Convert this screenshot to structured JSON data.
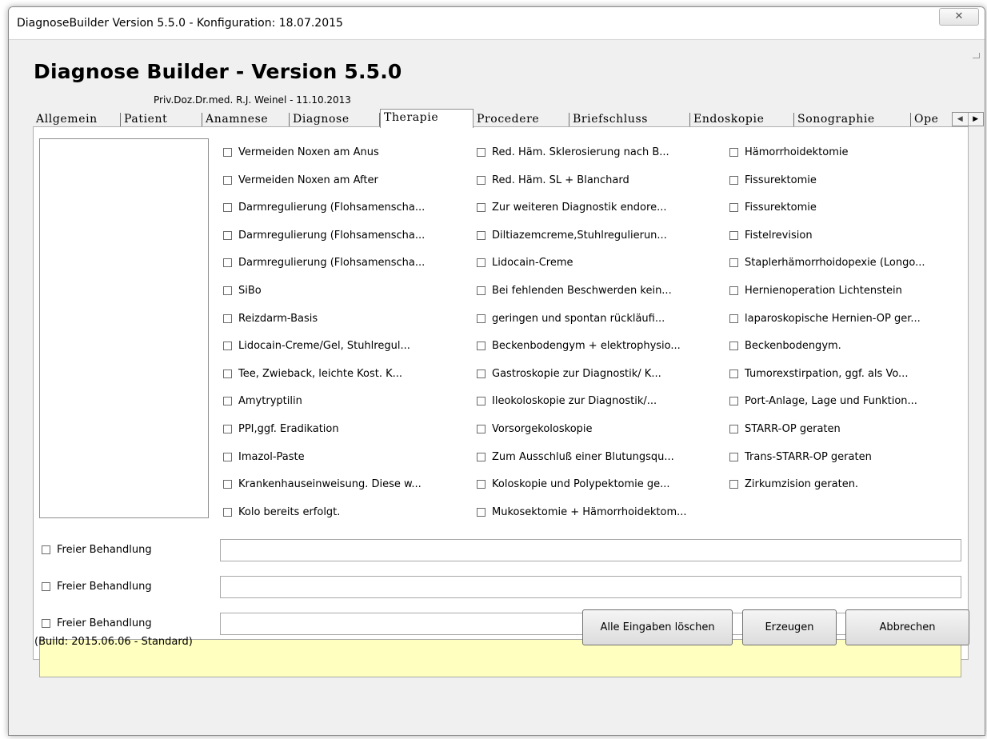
{
  "window": {
    "title": "DiagnoseBuilder Version 5.5.0 - Konfiguration: 18.07.2015",
    "close_glyph": "✕"
  },
  "header": {
    "app_title": "Diagnose Builder - Version 5.5.0",
    "author": "Priv.Doz.Dr.med. R.J. Weinel - 11.10.2013"
  },
  "tabs": [
    {
      "label": "Allgemein"
    },
    {
      "label": "Patient"
    },
    {
      "label": "Anamnese"
    },
    {
      "label": "Diagnose"
    },
    {
      "label": "Therapie",
      "active": true
    },
    {
      "label": "Procedere"
    },
    {
      "label": "Briefschluss"
    },
    {
      "label": "Endoskopie"
    },
    {
      "label": "Sonographie"
    },
    {
      "label": "Ope"
    }
  ],
  "tab_scroll": {
    "left": "◀",
    "right": "▶"
  },
  "checkbox_columns": [
    [
      "Vermeiden Noxen am Anus",
      "Vermeiden Noxen am After",
      "Darmregulierung (Flohsamenscha...",
      "Darmregulierung (Flohsamenscha...",
      "Darmregulierung (Flohsamenscha...",
      "SiBo",
      "Reizdarm-Basis",
      "Lidocain-Creme/Gel, Stuhlregul...",
      "Tee, Zwieback, leichte Kost. K...",
      "Amytryptilin",
      "PPI,ggf. Eradikation",
      "Imazol-Paste",
      "Krankenhauseinweisung. Diese w...",
      "Kolo bereits erfolgt."
    ],
    [
      "Red. Häm. Sklerosierung nach B...",
      "Red. Häm. SL + Blanchard",
      "Zur weiteren Diagnostik endore...",
      "Diltiazemcreme,Stuhlregulierun...",
      "Lidocain-Creme",
      "Bei fehlenden Beschwerden kein...",
      "geringen und spontan rückläufi...",
      "Beckenbodengym + elektrophysio...",
      "Gastroskopie zur Diagnostik/ K...",
      "Ileokoloskopie zur Diagnostik/...",
      "Vorsorgekoloskopie",
      "Zum Ausschluß einer Blutungsqu...",
      "Koloskopie und Polypektomie ge...",
      "Mukosektomie + Hämorrhoidektom..."
    ],
    [
      "Hämorrhoidektomie",
      "Fissurektomie",
      "Fissurektomie",
      "Fistelrevision",
      "Staplerhämorrhoidopexie (Longo...",
      "Hernienoperation Lichtenstein",
      "laparoskopische Hernien-OP ger...",
      "Beckenbodengym.",
      "Tumorexstirpation, ggf. als Vo...",
      "Port-Anlage, Lage und Funktion...",
      "STARR-OP geraten",
      "Trans-STARR-OP geraten",
      "Zirkumzision geraten."
    ]
  ],
  "free_rows": [
    {
      "label": "Freier Behandlung",
      "value": ""
    },
    {
      "label": "Freier Behandlung",
      "value": ""
    },
    {
      "label": "Freier Behandlung",
      "value": ""
    }
  ],
  "footer": {
    "build": "(Build: 2015.06.06 - Standard)",
    "clear_label": "Alle Eingaben löschen",
    "generate_label": "Erzeugen",
    "cancel_label": "Abbrechen"
  }
}
